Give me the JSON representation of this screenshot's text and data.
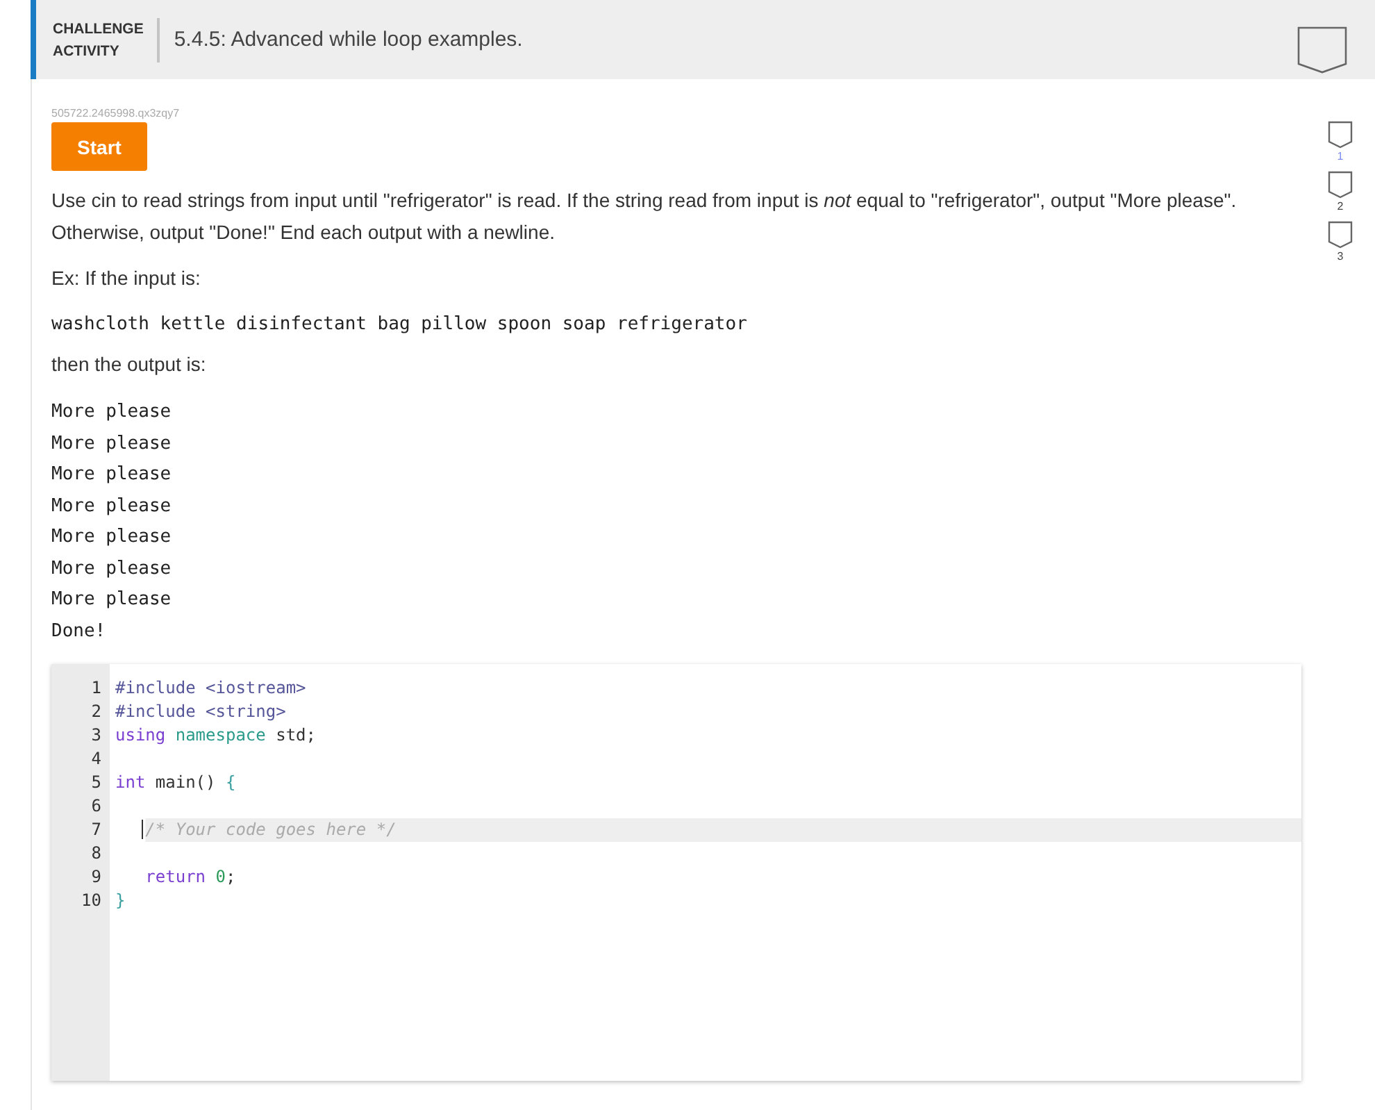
{
  "header": {
    "label_line_1": "CHALLENGE",
    "label_line_2": "ACTIVITY",
    "title": "5.4.5: Advanced while loop examples."
  },
  "activity_id": "505722.2465998.qx3zqy7",
  "start_button": "Start",
  "levels": [
    {
      "label": "1",
      "selected": true
    },
    {
      "label": "2",
      "selected": false
    },
    {
      "label": "3",
      "selected": false
    }
  ],
  "instructions": "Use cin to read strings from input until \"refrigerator\" is read. If the string read from input is *not* equal to \"refrigerator\", output \"More please\". Otherwise, output \"Done!\" End each output with a newline.",
  "example_intro": "Ex: If the input is:",
  "example_input": "washcloth kettle disinfectant bag pillow spoon soap refrigerator",
  "output_intro": "then the output is:",
  "example_output": [
    "More please",
    "More please",
    "More please",
    "More please",
    "More please",
    "More please",
    "More please",
    "Done!"
  ],
  "editor": {
    "lines": [
      {
        "number": "1",
        "active": false,
        "indented": false,
        "tokens": [
          {
            "kind": "meta",
            "text": "#include <iostream>",
            "space_before": false
          }
        ]
      },
      {
        "number": "2",
        "active": false,
        "indented": false,
        "tokens": [
          {
            "kind": "meta",
            "text": "#include <string>",
            "space_before": false
          }
        ]
      },
      {
        "number": "3",
        "active": false,
        "indented": false,
        "tokens": [
          {
            "kind": "keyword",
            "text": "using",
            "space_before": false
          },
          {
            "kind": "name",
            "text": "namespace",
            "space_before": true
          },
          {
            "kind": "plain",
            "text": "std;",
            "space_before": true
          }
        ]
      },
      {
        "number": "4",
        "active": false
      },
      {
        "number": "5",
        "active": false,
        "indented": false,
        "tokens": [
          {
            "kind": "keyword",
            "text": "int",
            "space_before": false
          },
          {
            "kind": "plain",
            "text": "main()",
            "space_before": true
          },
          {
            "kind": "bracket",
            "text": "{",
            "space_before": true
          }
        ]
      },
      {
        "number": "6",
        "active": false
      },
      {
        "number": "7",
        "active": true,
        "indented": true,
        "tokens": [
          {
            "kind": "comment",
            "text": "/* Your code goes here */",
            "space_before": false
          }
        ]
      },
      {
        "number": "8",
        "active": false
      },
      {
        "number": "9",
        "active": false,
        "indented": true,
        "tokens": [
          {
            "kind": "keyword",
            "text": "return",
            "space_before": false
          },
          {
            "kind": "number",
            "text": "0",
            "space_before": true
          },
          {
            "kind": "plain",
            "text": ";",
            "space_before": false
          }
        ]
      },
      {
        "number": "10",
        "active": false,
        "indented": false,
        "tokens": [
          {
            "kind": "bracket",
            "text": "}",
            "space_before": false
          }
        ]
      }
    ]
  }
}
